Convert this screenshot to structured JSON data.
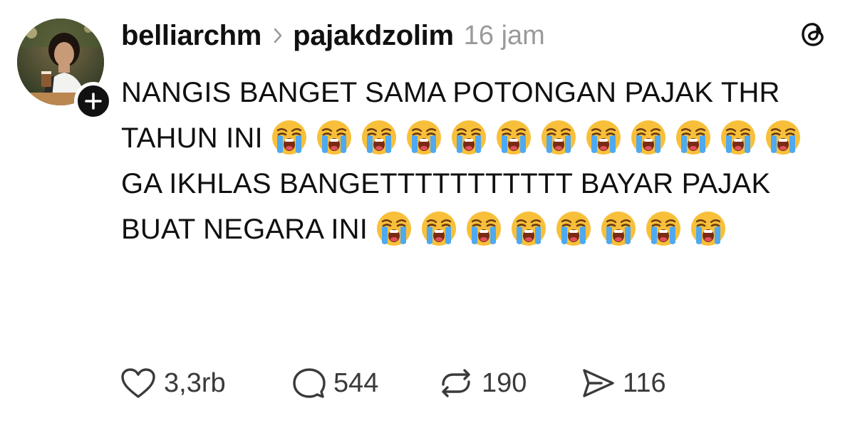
{
  "post": {
    "author": "belliarchm",
    "target": "pajakdzolim",
    "time": "16 jam",
    "paragraph1": "NANGIS BANGET SAMA POTONGAN PAJAK THR TAHUN INI",
    "paragraph2": "GA IKHLAS BANGETTTTTTTTTTT BAYAR PAJAK BUAT NEGARA INI",
    "emoji_paragraph1": [
      "loudly-crying-face",
      "loudly-crying-face",
      "loudly-crying-face",
      "loudly-crying-face",
      "loudly-crying-face",
      "loudly-crying-face",
      "loudly-crying-face",
      "loudly-crying-face",
      "loudly-crying-face",
      "loudly-crying-face",
      "loudly-crying-face",
      "loudly-crying-face"
    ],
    "emoji_paragraph2": [
      "loudly-crying-face",
      "loudly-crying-face",
      "loudly-crying-face",
      "loudly-crying-face",
      "loudly-crying-face",
      "loudly-crying-face",
      "loudly-crying-face",
      "loudly-crying-face"
    ]
  },
  "actions": {
    "likes": "3,3rb",
    "replies": "544",
    "reposts": "190",
    "shares": "116"
  },
  "icons": {
    "follow": "plus-icon",
    "separator": "chevron-right-icon",
    "app_logo": "threads-logo-icon",
    "like": "heart-icon",
    "reply": "comment-bubble-icon",
    "repost": "repost-icon",
    "share": "send-icon"
  },
  "colors": {
    "text": "#101010",
    "muted": "#9a9a9a",
    "action_text": "#3a3a3a"
  }
}
